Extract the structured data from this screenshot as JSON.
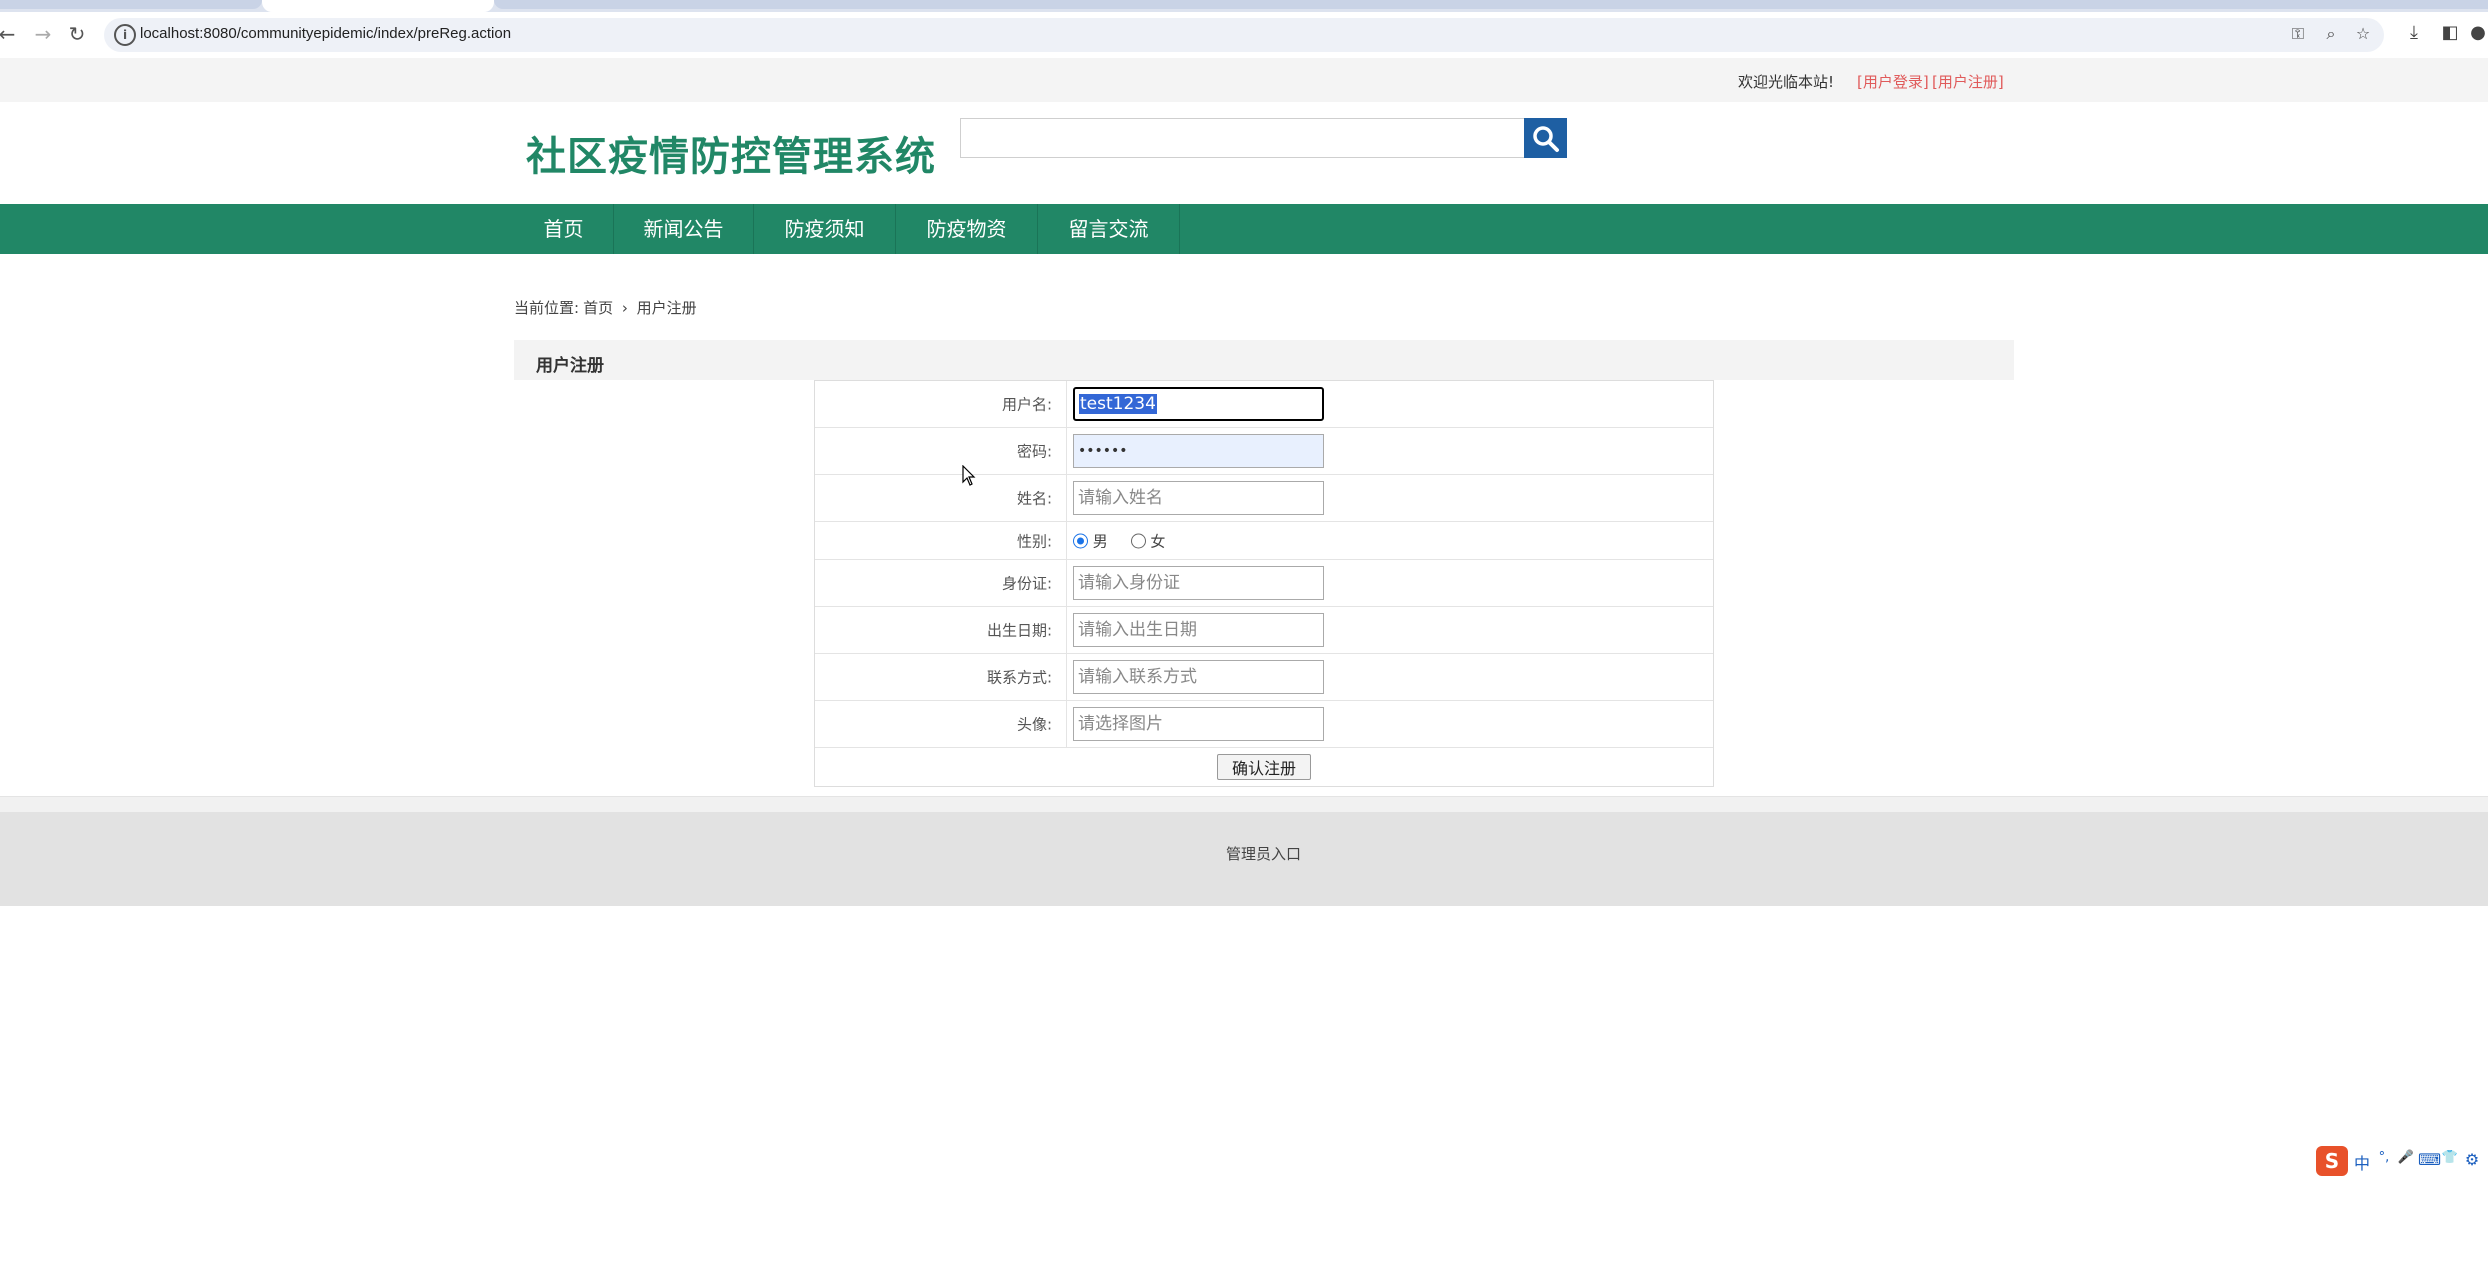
{
  "browser": {
    "url": "localhost:8080/communityepidemic/index/preReg.action"
  },
  "topbar": {
    "welcome": "欢迎光临本站!",
    "login_link": "[用户登录]",
    "register_link": "[用户注册]"
  },
  "header": {
    "site_title": "社区疫情防控管理系统",
    "search_placeholder": ""
  },
  "nav": {
    "items": [
      "首页",
      "新闻公告",
      "防疫须知",
      "防疫物资",
      "留言交流"
    ]
  },
  "breadcrumb": {
    "prefix": "当前位置:",
    "home": "首页",
    "separator": "›",
    "current": "用户注册"
  },
  "section": {
    "title": "用户注册"
  },
  "form": {
    "username": {
      "label": "用户名:",
      "value": "test1234"
    },
    "password": {
      "label": "密码:",
      "value": "••••••"
    },
    "name": {
      "label": "姓名:",
      "placeholder": "请输入姓名"
    },
    "gender": {
      "label": "性别:",
      "male": "男",
      "female": "女",
      "selected": "男"
    },
    "id_card": {
      "label": "身份证:",
      "placeholder": "请输入身份证"
    },
    "birth_date": {
      "label": "出生日期:",
      "placeholder": "请输入出生日期"
    },
    "contact": {
      "label": "联系方式:",
      "placeholder": "请输入联系方式"
    },
    "avatar": {
      "label": "头像:",
      "placeholder": "请选择图片"
    },
    "submit_label": "确认注册"
  },
  "footer": {
    "admin_link": "管理员入口"
  },
  "ime": {
    "logo": "S",
    "items": [
      "中",
      "°,",
      "🎤",
      "⌨",
      "👕",
      "⚙"
    ]
  },
  "colors": {
    "brand_green": "#218766",
    "search_blue": "#1e5fa3",
    "link_red": "#e05a5a"
  }
}
